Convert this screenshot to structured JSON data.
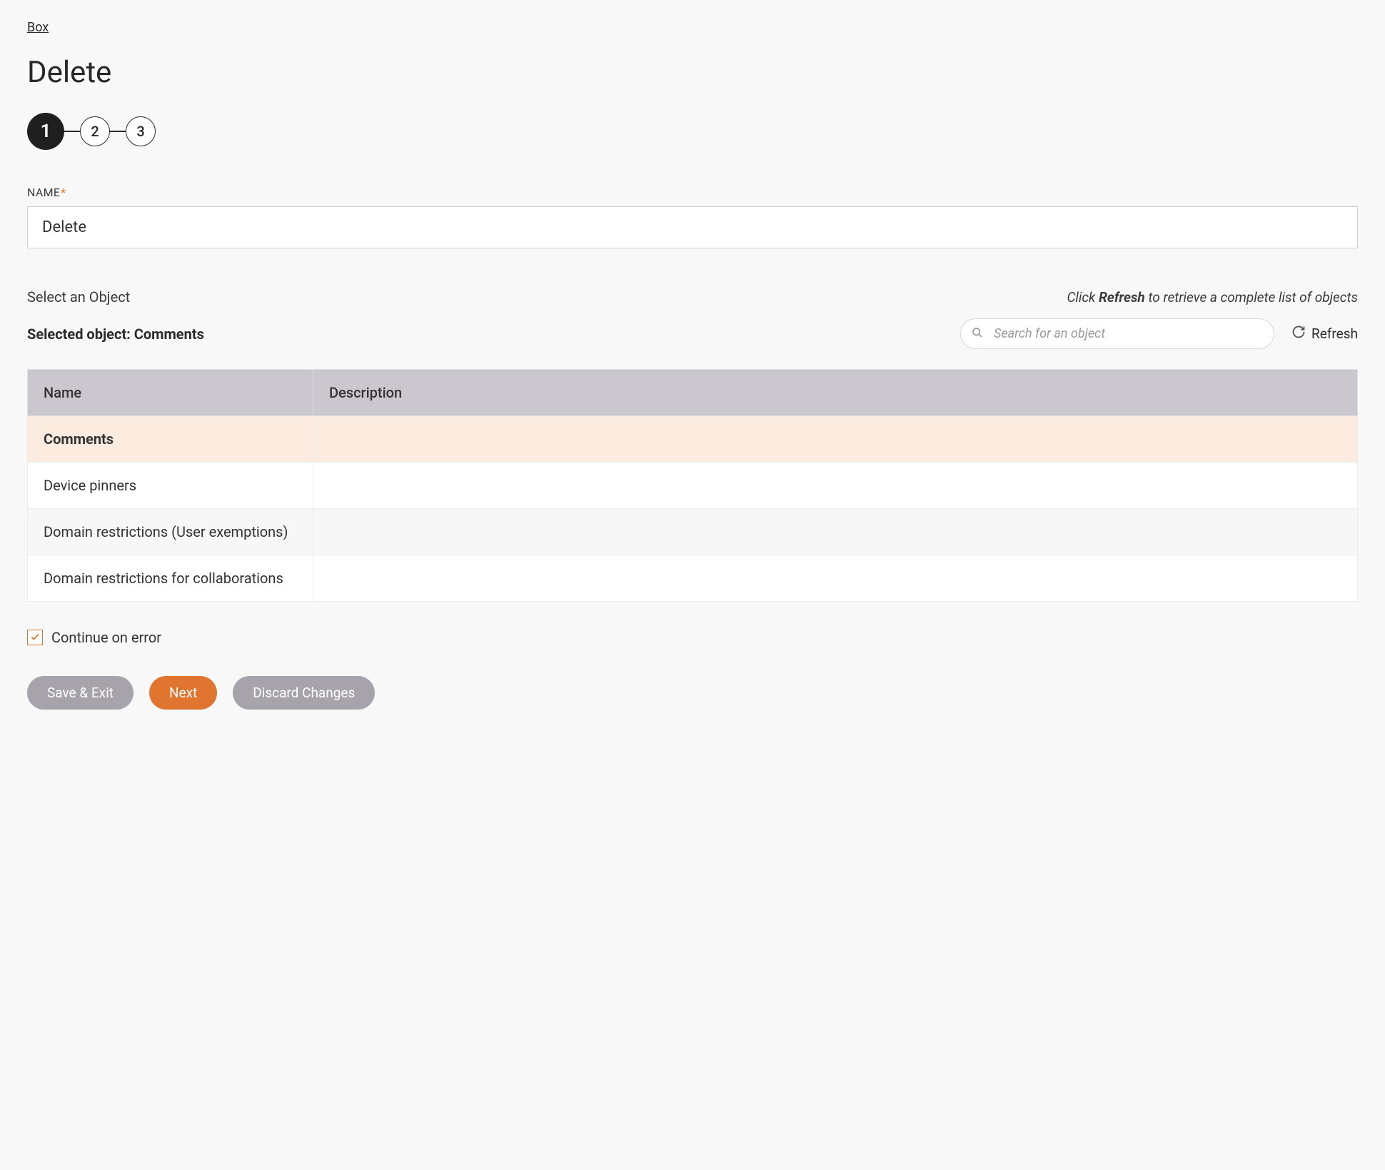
{
  "breadcrumb": "Box",
  "page_title": "Delete",
  "stepper": {
    "steps": [
      "1",
      "2",
      "3"
    ],
    "active_index": 0
  },
  "name_field": {
    "label": "NAME",
    "required_mark": "*",
    "value": "Delete"
  },
  "object_section": {
    "subtitle": "Select an Object",
    "info_prefix": "Click ",
    "info_bold": "Refresh",
    "info_suffix": " to retrieve a complete list of objects",
    "selected_label": "Selected object: ",
    "selected_value": "Comments",
    "search_placeholder": "Search for an object",
    "refresh_label": "Refresh"
  },
  "table": {
    "headers": [
      "Name",
      "Description"
    ],
    "rows": [
      {
        "name": "Comments",
        "description": "",
        "selected": true
      },
      {
        "name": "Device pinners",
        "description": "",
        "selected": false
      },
      {
        "name": "Domain restrictions (User exemptions)",
        "description": "",
        "selected": false
      },
      {
        "name": "Domain restrictions for collaborations",
        "description": "",
        "selected": false
      }
    ]
  },
  "continue_on_error": {
    "label": "Continue on error",
    "checked": true
  },
  "buttons": {
    "save_exit": "Save & Exit",
    "next": "Next",
    "discard": "Discard Changes"
  }
}
